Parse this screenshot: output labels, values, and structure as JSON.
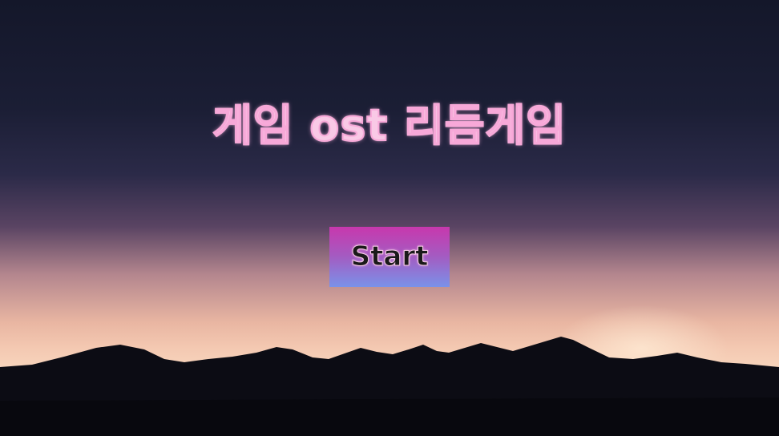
{
  "game": {
    "title": "게임 ost 리듬게임",
    "start_label": "Start"
  },
  "colors": {
    "title_fill": "#f9c9e6",
    "title_outline": "#f7a8d8",
    "button_top": "#c838ad",
    "button_bottom": "#7a92e9",
    "sky_top": "#14172a",
    "horizon": "#f7d3bb",
    "mountains": "#0c0c14"
  }
}
